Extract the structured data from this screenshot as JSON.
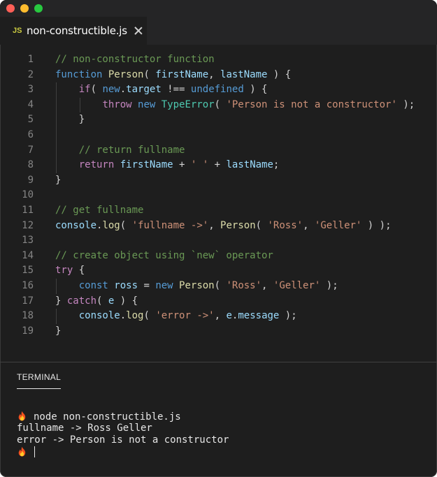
{
  "tab": {
    "icon_label": "JS",
    "file_name": "non-constructible.js"
  },
  "editor": {
    "lines": [
      {
        "n": "1",
        "tokens": [
          {
            "t": "// non-constructor function",
            "c": "comment"
          }
        ]
      },
      {
        "n": "2",
        "tokens": [
          {
            "t": "function ",
            "c": "kw"
          },
          {
            "t": "Person",
            "c": "fn"
          },
          {
            "t": "( ",
            "c": "plain"
          },
          {
            "t": "firstName",
            "c": "var"
          },
          {
            "t": ", ",
            "c": "plain"
          },
          {
            "t": "lastName",
            "c": "var"
          },
          {
            "t": " ) {",
            "c": "plain"
          }
        ]
      },
      {
        "n": "3",
        "tokens": [
          {
            "t": "    ",
            "c": "plain"
          },
          {
            "t": "if",
            "c": "ctrl"
          },
          {
            "t": "( ",
            "c": "plain"
          },
          {
            "t": "new",
            "c": "kw"
          },
          {
            "t": ".",
            "c": "plain"
          },
          {
            "t": "target",
            "c": "var"
          },
          {
            "t": " !== ",
            "c": "plain"
          },
          {
            "t": "undefined",
            "c": "kw"
          },
          {
            "t": " ) {",
            "c": "plain"
          }
        ]
      },
      {
        "n": "4",
        "tokens": [
          {
            "t": "        ",
            "c": "plain"
          },
          {
            "t": "throw ",
            "c": "ctrl"
          },
          {
            "t": "new ",
            "c": "kw"
          },
          {
            "t": "TypeError",
            "c": "type"
          },
          {
            "t": "( ",
            "c": "plain"
          },
          {
            "t": "'Person is not a constructor'",
            "c": "str"
          },
          {
            "t": " );",
            "c": "plain"
          }
        ]
      },
      {
        "n": "5",
        "tokens": [
          {
            "t": "    }",
            "c": "plain"
          }
        ]
      },
      {
        "n": "6",
        "tokens": []
      },
      {
        "n": "7",
        "tokens": [
          {
            "t": "    ",
            "c": "plain"
          },
          {
            "t": "// return fullname",
            "c": "comment"
          }
        ]
      },
      {
        "n": "8",
        "tokens": [
          {
            "t": "    ",
            "c": "plain"
          },
          {
            "t": "return ",
            "c": "ctrl"
          },
          {
            "t": "firstName",
            "c": "var"
          },
          {
            "t": " + ",
            "c": "plain"
          },
          {
            "t": "' '",
            "c": "str"
          },
          {
            "t": " + ",
            "c": "plain"
          },
          {
            "t": "lastName",
            "c": "var"
          },
          {
            "t": ";",
            "c": "plain"
          }
        ]
      },
      {
        "n": "9",
        "tokens": [
          {
            "t": "}",
            "c": "plain"
          }
        ]
      },
      {
        "n": "10",
        "tokens": []
      },
      {
        "n": "11",
        "tokens": [
          {
            "t": "// get fullname",
            "c": "comment"
          }
        ]
      },
      {
        "n": "12",
        "tokens": [
          {
            "t": "console",
            "c": "var"
          },
          {
            "t": ".",
            "c": "plain"
          },
          {
            "t": "log",
            "c": "fn"
          },
          {
            "t": "( ",
            "c": "plain"
          },
          {
            "t": "'fullname ->'",
            "c": "str"
          },
          {
            "t": ", ",
            "c": "plain"
          },
          {
            "t": "Person",
            "c": "fn"
          },
          {
            "t": "( ",
            "c": "plain"
          },
          {
            "t": "'Ross'",
            "c": "str"
          },
          {
            "t": ", ",
            "c": "plain"
          },
          {
            "t": "'Geller'",
            "c": "str"
          },
          {
            "t": " ) );",
            "c": "plain"
          }
        ]
      },
      {
        "n": "13",
        "tokens": []
      },
      {
        "n": "14",
        "tokens": [
          {
            "t": "// create object using `new` operator",
            "c": "comment"
          }
        ]
      },
      {
        "n": "15",
        "tokens": [
          {
            "t": "try",
            "c": "ctrl"
          },
          {
            "t": " {",
            "c": "plain"
          }
        ]
      },
      {
        "n": "16",
        "tokens": [
          {
            "t": "    ",
            "c": "plain"
          },
          {
            "t": "const ",
            "c": "kw"
          },
          {
            "t": "ross",
            "c": "var"
          },
          {
            "t": " = ",
            "c": "plain"
          },
          {
            "t": "new ",
            "c": "kw"
          },
          {
            "t": "Person",
            "c": "fn"
          },
          {
            "t": "( ",
            "c": "plain"
          },
          {
            "t": "'Ross'",
            "c": "str"
          },
          {
            "t": ", ",
            "c": "plain"
          },
          {
            "t": "'Geller'",
            "c": "str"
          },
          {
            "t": " );",
            "c": "plain"
          }
        ]
      },
      {
        "n": "17",
        "tokens": [
          {
            "t": "} ",
            "c": "plain"
          },
          {
            "t": "catch",
            "c": "ctrl"
          },
          {
            "t": "( ",
            "c": "plain"
          },
          {
            "t": "e",
            "c": "var"
          },
          {
            "t": " ) {",
            "c": "plain"
          }
        ]
      },
      {
        "n": "18",
        "tokens": [
          {
            "t": "    ",
            "c": "plain"
          },
          {
            "t": "console",
            "c": "var"
          },
          {
            "t": ".",
            "c": "plain"
          },
          {
            "t": "log",
            "c": "fn"
          },
          {
            "t": "( ",
            "c": "plain"
          },
          {
            "t": "'error ->'",
            "c": "str"
          },
          {
            "t": ", ",
            "c": "plain"
          },
          {
            "t": "e",
            "c": "var"
          },
          {
            "t": ".",
            "c": "plain"
          },
          {
            "t": "message",
            "c": "var"
          },
          {
            "t": " );",
            "c": "plain"
          }
        ]
      },
      {
        "n": "19",
        "tokens": [
          {
            "t": "}",
            "c": "plain"
          }
        ]
      }
    ]
  },
  "panel": {
    "tab_label": "TERMINAL"
  },
  "terminal": {
    "prompt_icon": "flame-icon",
    "lines": [
      {
        "prompt": true,
        "text": "node non-constructible.js"
      },
      {
        "prompt": false,
        "text": "fullname -> Ross Geller"
      },
      {
        "prompt": false,
        "text": "error -> Person is not a constructor"
      }
    ]
  },
  "colors": {
    "comment": "#6a9955",
    "keyword": "#569cd6",
    "control": "#c586c0",
    "function": "#dcdcaa",
    "variable": "#9cdcfe",
    "string": "#ce9178",
    "type": "#4ec9b0"
  }
}
